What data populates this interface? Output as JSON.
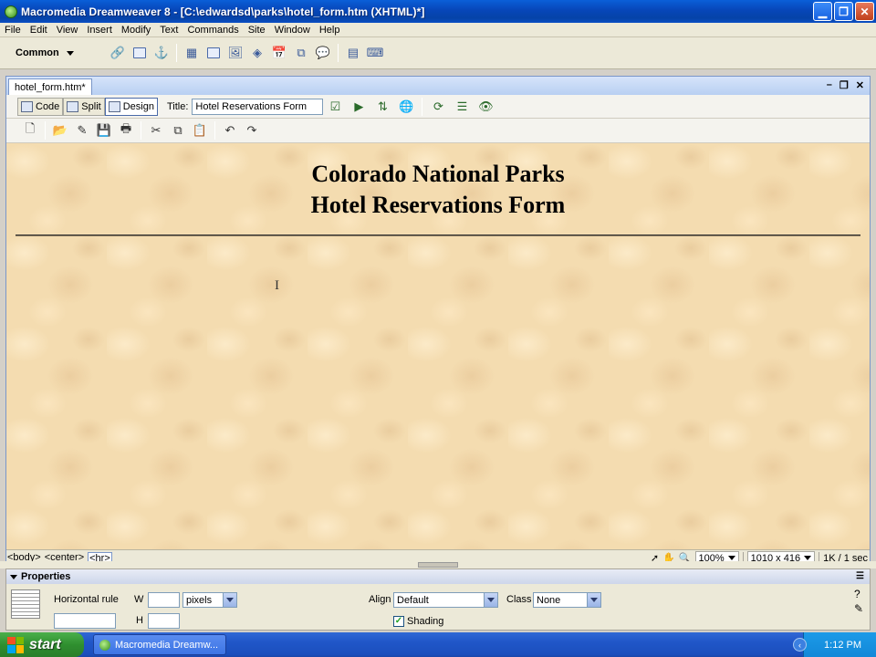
{
  "window": {
    "title": "Macromedia Dreamweaver 8 - [C:\\edwardsd\\parks\\hotel_form.htm (XHTML)*]"
  },
  "menu": [
    "File",
    "Edit",
    "View",
    "Insert",
    "Modify",
    "Text",
    "Commands",
    "Site",
    "Window",
    "Help"
  ],
  "insert_bar": {
    "category": "Common"
  },
  "document": {
    "tab": "hotel_form.htm*",
    "views": {
      "code": "Code",
      "split": "Split",
      "design": "Design"
    },
    "title_label": "Title:",
    "title_value": "Hotel Reservations Form",
    "heading_line1": "Colorado National Parks",
    "heading_line2": "Hotel Reservations Form"
  },
  "status": {
    "tags": [
      "<body>",
      "<center>",
      "<hr>"
    ],
    "zoom": "100%",
    "dimensions": "1010 x 416",
    "size_time": "1K / 1 sec"
  },
  "properties": {
    "title": "Properties",
    "element_label": "Horizontal rule",
    "w_label": "W",
    "w_value": "",
    "units": "pixels",
    "h_label": "H",
    "h_value": "",
    "align_label": "Align",
    "align_value": "Default",
    "class_label": "Class",
    "class_value": "None",
    "shading_label": "Shading",
    "shading_checked": true
  },
  "taskbar": {
    "start_label": "start",
    "task_label": "Macromedia Dreamw...",
    "clock": "1:12 PM"
  }
}
